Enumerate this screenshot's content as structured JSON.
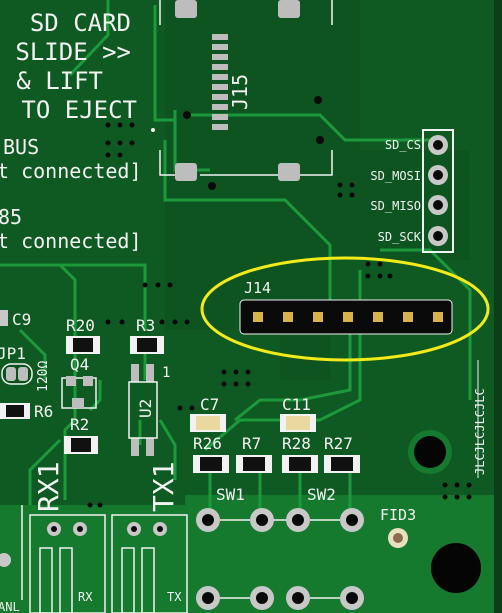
{
  "board": {
    "colors": {
      "soldermask": "#0f5a22",
      "copper_pour": "#157a2e",
      "trace": "#1c9a3b",
      "silkscreen": "#f2f2f2",
      "pad_gold": "#d8b24a",
      "highlight": "#f3ea1a"
    },
    "sd_notice": [
      "SD CARD",
      "SLIDE >>",
      "& LIFT",
      "TO EJECT"
    ],
    "bus1_label": "BUS",
    "bus1_status": "t connected]",
    "bus2_label": "85",
    "bus2_status": "t connected]",
    "sd_pins": [
      "SD_CS",
      "SD_MOSI",
      "SD_MISO",
      "SD_SCK"
    ],
    "refs": {
      "j15": "J15",
      "j14": "J14",
      "c9": "C9",
      "jp1": "JP1",
      "ohm": "120Ω",
      "r20": "R20",
      "q4": "Q4",
      "r3": "R3",
      "r6": "R6",
      "r2": "R2",
      "u2": "U2",
      "pin1": "1",
      "c7": "C7",
      "c11": "C11",
      "r26": "R26",
      "r7": "R7",
      "r28": "R28",
      "r27": "R27",
      "sw1": "SW1",
      "sw2": "SW2",
      "fid3": "FID3",
      "jlc": "JLCJLCJLCJLC",
      "rx1": "RX1",
      "tx1": "TX1",
      "rx": "RX",
      "tx": "TX",
      "anl": "ANL"
    },
    "j14_pin_count": 7
  }
}
